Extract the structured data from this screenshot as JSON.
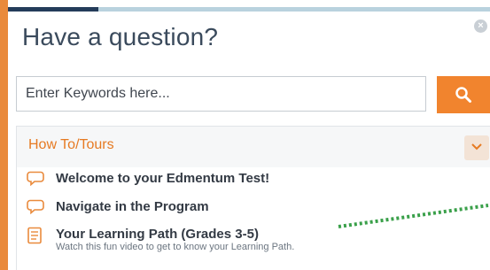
{
  "title": "Have a question?",
  "close_icon_glyph": "×",
  "search": {
    "placeholder": "Enter Keywords here...",
    "button_icon": "search-icon"
  },
  "section": {
    "title": "How To/Tours",
    "toggle_icon": "chevron-down-icon",
    "items": [
      {
        "icon": "speech-bubble-icon",
        "label": "Welcome to your Edmentum Test!"
      },
      {
        "icon": "speech-bubble-icon",
        "label": "Navigate in the Program"
      },
      {
        "icon": "document-icon",
        "label": "Your Learning Path (Grades 3-5)",
        "description": "Watch this fun video to get to know your Learning Path."
      }
    ]
  },
  "colors": {
    "accent_orange": "#f1842e",
    "heading_orange": "#e67a22",
    "accent_navy": "#243c5a",
    "accent_light_blue": "#b9d2de",
    "dotted_green": "#3aa04a"
  }
}
